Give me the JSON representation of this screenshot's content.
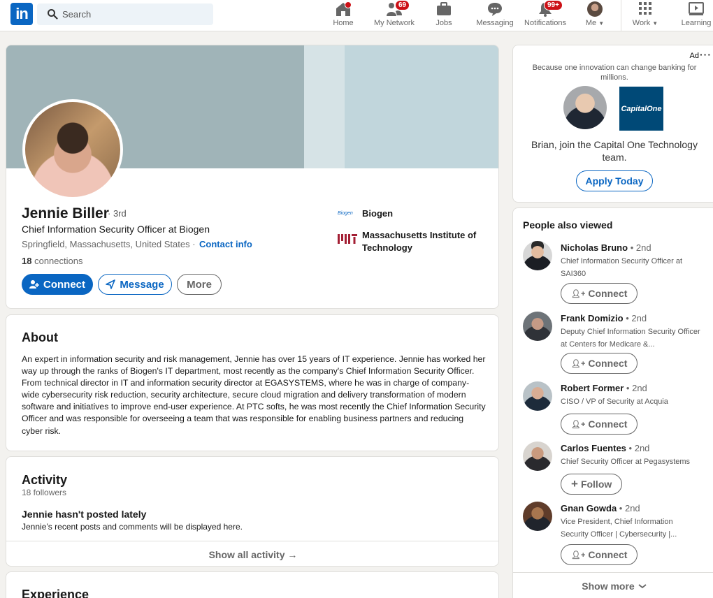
{
  "nav": {
    "search_placeholder": "Search",
    "items": [
      {
        "label": "Home"
      },
      {
        "label": "My Network",
        "badge": "69"
      },
      {
        "label": "Jobs"
      },
      {
        "label": "Messaging"
      },
      {
        "label": "Notifications",
        "badge": "99+"
      },
      {
        "label": "Me"
      },
      {
        "label": "Work"
      },
      {
        "label": "Learning"
      }
    ]
  },
  "profile": {
    "name": "Jennie Biller",
    "degree": "· 3rd",
    "headline": "Chief Information Security Officer at Biogen",
    "location": "Springfield, Massachusetts, United States ·",
    "contact_link": "Contact info",
    "connections_count": "18",
    "connections_label": "connections",
    "buttons": {
      "connect": "Connect",
      "message": "Message",
      "more": "More"
    },
    "company": "Biogen",
    "company_logo_text": "Biogen",
    "school": "Massachusetts Institute of Technology"
  },
  "about": {
    "title": "About",
    "text": "An expert in information security and risk management, Jennie has over 15 years of IT experience. Jennie has worked her way up through the ranks of Biogen's IT department, most recently as the company's Chief Information Security Officer. From technical director in IT and information security director at EGASYSTEMS, where he was in charge of company-wide cybersecurity risk reduction, security architecture, secure cloud migration and delivery transformation of modern software and initiatives to improve end-user experience. At PTC softs, he was most recently the Chief Information Security Officer and was responsible for overseeing a team that was responsible for enabling business partners and reducing cyber risk."
  },
  "activity": {
    "title": "Activity",
    "followers": "18 followers",
    "empty_title": "Jennie hasn't posted lately",
    "empty_sub": "Jennie’s recent posts and comments will be displayed here.",
    "show_all": "Show all activity →"
  },
  "experience": {
    "title": "Experience"
  },
  "ad": {
    "label": "Ad",
    "dots": "···",
    "tagline": "Because one innovation can change banking for millions.",
    "company_logo": "CapitalOne",
    "message": "Brian, join the Capital One Technology team.",
    "cta": "Apply Today"
  },
  "people_also_viewed": {
    "title": "People also viewed",
    "people": [
      {
        "name": "Nicholas Bruno",
        "degree": "• 2nd",
        "title": "Chief Information Security Officer at SAI360",
        "action": "Connect"
      },
      {
        "name": "Frank Domizio",
        "degree": "• 2nd",
        "title": "Deputy Chief Information Security Officer at Centers for Medicare &...",
        "action": "Connect"
      },
      {
        "name": "Robert Former",
        "degree": "• 2nd",
        "title": "CISO / VP of Security at Acquia",
        "action": "Connect"
      },
      {
        "name": "Carlos Fuentes",
        "degree": "• 2nd",
        "title": "Chief Security Officer at Pegasystems",
        "action": "Follow"
      },
      {
        "name": "Gnan Gowda",
        "degree": "• 2nd",
        "title": "Vice President, Chief Information Security Officer | Cybersecurity |...",
        "action": "Connect"
      }
    ],
    "show_more": "Show more"
  },
  "colors": {
    "brand": "#0a66c2",
    "badge": "#cc1016",
    "background": "#f3f2ef"
  }
}
